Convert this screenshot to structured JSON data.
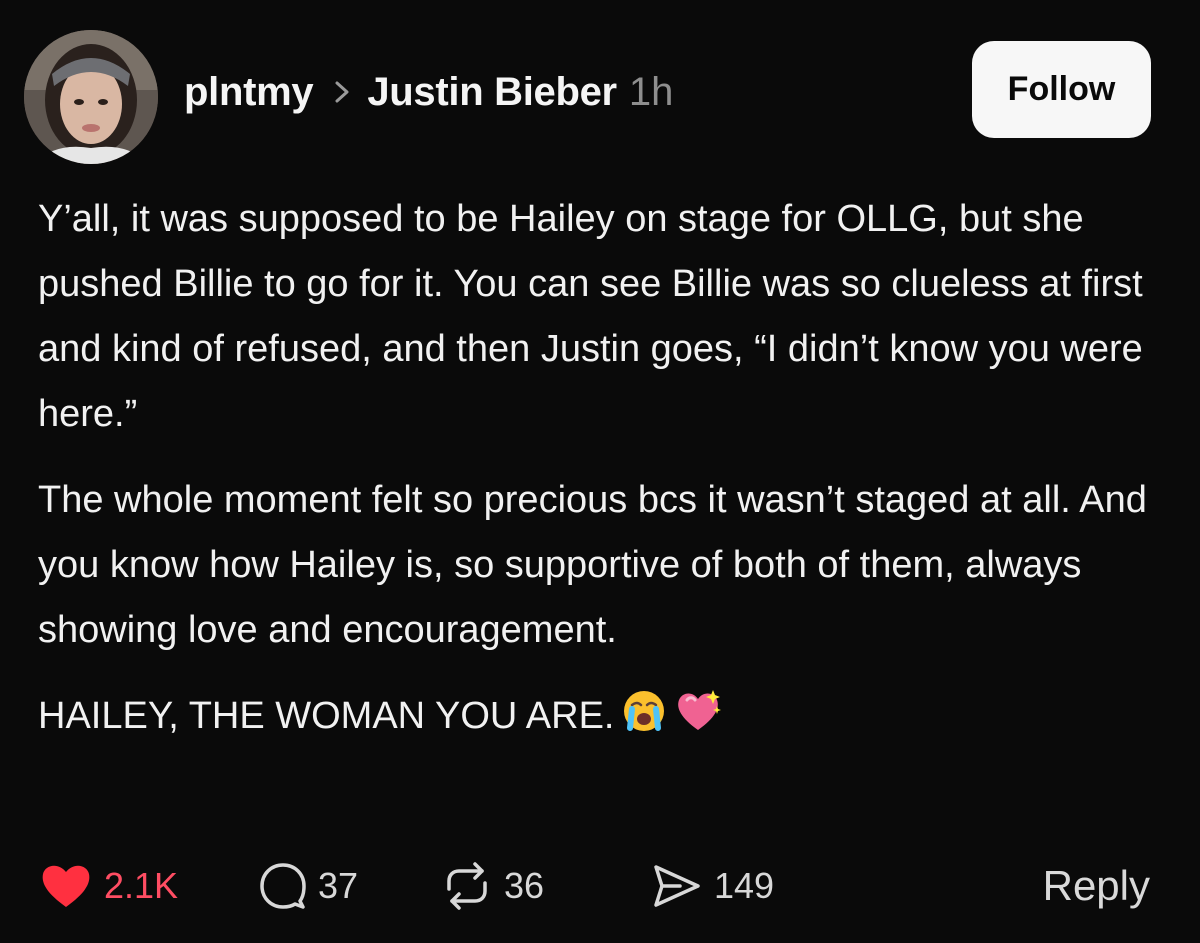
{
  "header": {
    "username": "plntmy",
    "topic": "Justin Bieber",
    "time_ago": "1h",
    "follow_label": "Follow"
  },
  "post": {
    "paragraphs": [
      "Y’all, it was supposed to be Hailey on stage for OLLG, but she pushed Billie to go for it. You can see Billie was so clueless at first and kind of refused, and then Justin goes, “I didn’t know you were here.”",
      "The whole moment felt so precious bcs it wasn’t staged at all. And you know how Hailey is, so supportive of both of them, always showing love and encouragement.",
      "HAILEY, THE WOMAN YOU ARE."
    ],
    "emoji_icons": [
      "loudly-crying-face-icon",
      "sparkling-heart-icon"
    ]
  },
  "actions": {
    "likes": "2.1K",
    "comments": "37",
    "reposts": "36",
    "shares": "149",
    "reply_label": "Reply"
  },
  "colors": {
    "background": "#0a0a0a",
    "like_red": "#ff3040",
    "muted_gray": "#8e8e8e",
    "follow_bg": "#f7f7f7"
  }
}
